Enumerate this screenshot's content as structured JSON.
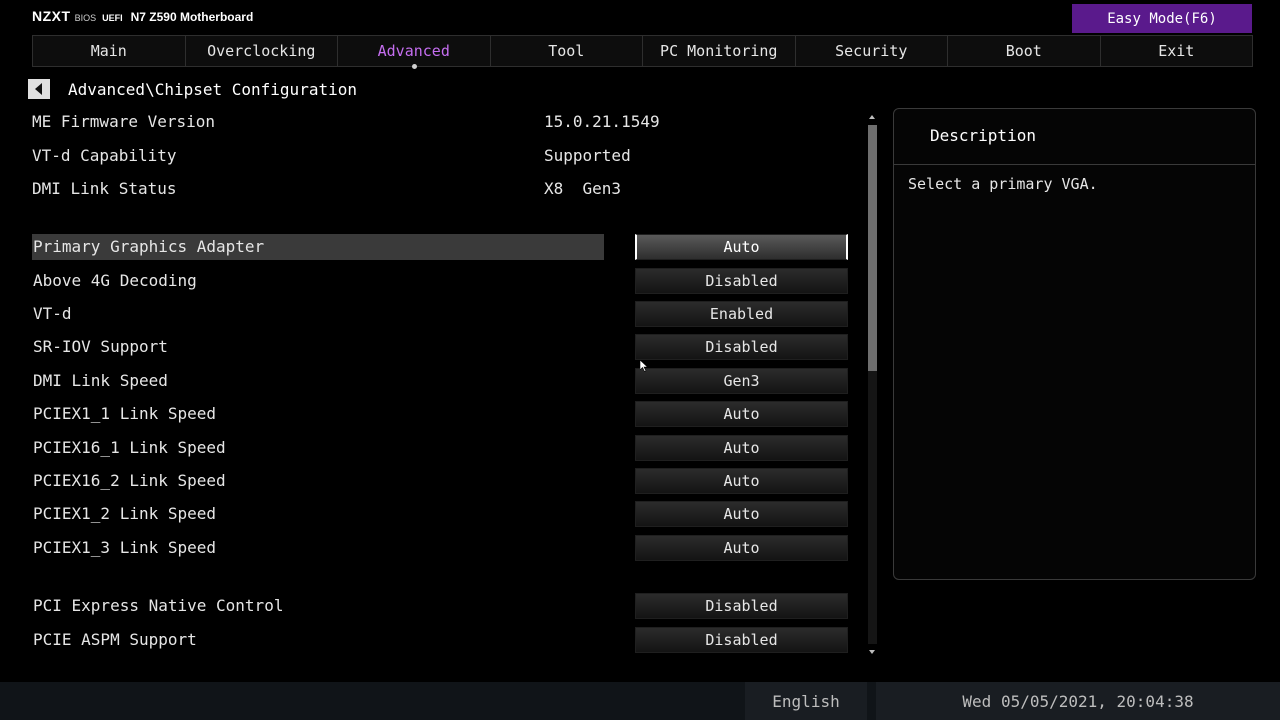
{
  "brand": {
    "logo": "NZXT",
    "bios": "BIOS",
    "uefi": "UEFI",
    "model": "N7 Z590 Motherboard"
  },
  "header": {
    "easy_mode_label": "Easy Mode(F6)"
  },
  "tabs": [
    {
      "label": "Main"
    },
    {
      "label": "Overclocking"
    },
    {
      "label": "Advanced",
      "active": true
    },
    {
      "label": "Tool"
    },
    {
      "label": "PC Monitoring"
    },
    {
      "label": "Security"
    },
    {
      "label": "Boot"
    },
    {
      "label": "Exit"
    }
  ],
  "breadcrumb": "Advanced\\Chipset Configuration",
  "info": [
    {
      "label": "ME Firmware Version",
      "value": "15.0.21.1549"
    },
    {
      "label": "VT-d Capability",
      "value": "Supported"
    },
    {
      "label": "DMI Link Status",
      "value": "X8  Gen3"
    }
  ],
  "settings": [
    {
      "label": "Primary Graphics Adapter",
      "value": "Auto",
      "selected": true
    },
    {
      "label": "Above 4G Decoding",
      "value": "Disabled"
    },
    {
      "label": "VT-d",
      "value": "Enabled"
    },
    {
      "label": "SR-IOV Support",
      "value": "Disabled"
    },
    {
      "label": "DMI Link Speed",
      "value": "Gen3"
    },
    {
      "label": "PCIEX1_1 Link Speed",
      "value": "Auto"
    },
    {
      "label": "PCIEX16_1 Link Speed",
      "value": "Auto"
    },
    {
      "label": "PCIEX16_2 Link Speed",
      "value": "Auto"
    },
    {
      "label": "PCIEX1_2 Link Speed",
      "value": "Auto"
    },
    {
      "label": "PCIEX1_3 Link Speed",
      "value": "Auto"
    },
    {
      "label": "PCI Express Native Control",
      "value": "Disabled"
    },
    {
      "label": "PCIE ASPM Support",
      "value": "Disabled"
    }
  ],
  "description": {
    "title": "Description",
    "text": "Select a primary VGA."
  },
  "footer": {
    "language": "English",
    "datetime": "Wed 05/05/2021, 20:04:38"
  },
  "colors": {
    "accent_purple": "#c56ef0",
    "easy_mode_bg": "#5a1a8c",
    "selected_row_bg": "#3a3a3a"
  }
}
